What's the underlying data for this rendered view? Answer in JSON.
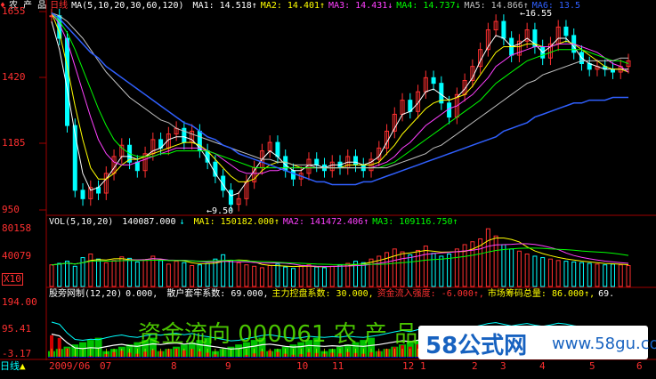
{
  "main": {
    "title": "农 产 品",
    "period": "日线",
    "ma_params": "MA(5,10,20,30,60,120)",
    "ma_values": [
      {
        "label": "MA1:",
        "value": "14.518",
        "arrow": "↑",
        "color": "#ffffff"
      },
      {
        "label": "MA2:",
        "value": "14.401",
        "arrow": "↑",
        "color": "#ffff00"
      },
      {
        "label": "MA3:",
        "value": "14.431",
        "arrow": "↓",
        "color": "#ff40ff"
      },
      {
        "label": "MA4:",
        "value": "14.737",
        "arrow": "↓",
        "color": "#00ff00"
      },
      {
        "label": "MA5:",
        "value": "14.866",
        "arrow": "↑",
        "color": "#c0c0c0"
      },
      {
        "label": "MA6:",
        "value": "13.5",
        "arrow": "",
        "color": "#3060ff"
      }
    ],
    "price_labels": [
      "1655",
      "1420",
      "1185",
      "950"
    ],
    "high_annotation": "16.55",
    "low_annotation": "9.50"
  },
  "volume": {
    "header": "VOL(5,10,20)",
    "vol_value": "140087.000",
    "vol_arrow": "↓",
    "ma_values": [
      {
        "label": "MA1:",
        "value": "150182.000",
        "arrow": "↑",
        "color": "#ffff00"
      },
      {
        "label": "MA2:",
        "value": "141472.406",
        "arrow": "↑",
        "color": "#ff40ff"
      },
      {
        "label": "MA3:",
        "value": "109116.750",
        "arrow": "↑",
        "color": "#00ff00"
      }
    ],
    "axis_labels": [
      "80158",
      "40079"
    ],
    "multiplier": "X10"
  },
  "indicator": {
    "name": "股旁网制(12,20)",
    "value0": "0.000,",
    "items": [
      {
        "label": "散户套牢系数:",
        "value": "69.000,",
        "color": "#ffffff"
      },
      {
        "label": "主力控盘系数:",
        "value": "30.000,",
        "color": "#ffff00"
      },
      {
        "label": "资金流入强度:",
        "value": "-6.000",
        "arrow": "↑,",
        "color": "#ff3030"
      },
      {
        "label": "市场筹码总量:",
        "value": "86.000",
        "arrow": "↑,",
        "color": "#ffff00"
      },
      {
        "label": "",
        "value": "69.",
        "color": "#ffffff"
      }
    ],
    "axis_labels": [
      "194.00",
      "95.41",
      "-3.17"
    ]
  },
  "xaxis": {
    "period_button": "日线",
    "ticks": [
      "2009/06",
      "07",
      "8",
      "9",
      "10",
      "11",
      "12",
      "1",
      "2",
      "3",
      "4",
      "5",
      "6"
    ]
  },
  "watermark": "资金流向 000061 农 产 品",
  "logo": {
    "text": "58公式网",
    "url": "www.58gu.com"
  },
  "colors": {
    "up": "#ff3030",
    "down": "#00ffff",
    "ma1": "#ffffff",
    "ma2": "#ffff00",
    "ma3": "#ff40ff",
    "ma4": "#00ff00",
    "ma5": "#c0c0c0",
    "ma6": "#3060ff"
  },
  "chart_data": {
    "type": "line",
    "y_range": [
      9.5,
      16.55
    ],
    "close_series": {
      "name": "close",
      "values": [
        16.4,
        15.6,
        12.5,
        10.2,
        9.9,
        10.3,
        10.1,
        10.8,
        11.4,
        11.8,
        11.2,
        10.9,
        11.5,
        12.0,
        11.7,
        12.2,
        12.4,
        11.9,
        12.3,
        11.6,
        11.2,
        10.7,
        10.2,
        9.7,
        9.9,
        10.5,
        11.0,
        11.6,
        11.9,
        11.4,
        10.9,
        10.6,
        10.8,
        11.3,
        11.1,
        10.9,
        11.2,
        11.0,
        11.4,
        11.1,
        10.9,
        11.3,
        11.7,
        12.3,
        12.9,
        13.4,
        13.0,
        13.7,
        14.2,
        14.0,
        13.3,
        12.8,
        13.6,
        14.1,
        14.6,
        15.2,
        15.9,
        16.2,
        15.6,
        15.0,
        15.5,
        15.9,
        15.3,
        14.9,
        15.4,
        16.0,
        15.7,
        15.1,
        14.7,
        14.5,
        14.6,
        14.5,
        14.4,
        14.6,
        14.8
      ]
    },
    "ma_series": [
      {
        "name": "MA1",
        "values": [
          16.2,
          15.2,
          13.8,
          12.2,
          10.8,
          10.2,
          10.3,
          10.6,
          11.0,
          11.4,
          11.4,
          11.3,
          11.4,
          11.6,
          11.7,
          12.0,
          12.1,
          12.1,
          12.0,
          11.7,
          11.3,
          10.8,
          10.4,
          10.0,
          10.1,
          10.5,
          10.9,
          11.3,
          11.6,
          11.4,
          11.1,
          10.9,
          10.9,
          11.1,
          11.1,
          11.0,
          11.1,
          11.1,
          11.2,
          11.2,
          11.1,
          11.2,
          11.4,
          11.9,
          12.4,
          12.9,
          13.0,
          13.3,
          13.7,
          13.8,
          13.6,
          13.4,
          13.5,
          13.8,
          14.2,
          14.8,
          15.3,
          15.7,
          15.6,
          15.3,
          15.4,
          15.6,
          15.4,
          15.1,
          15.3,
          15.6,
          15.6,
          15.3,
          14.9,
          14.7,
          14.6,
          14.5,
          14.5,
          14.5,
          14.5
        ]
      },
      {
        "name": "MA2",
        "values": [
          16.5,
          15.8,
          14.6,
          13.2,
          12.0,
          11.0,
          10.6,
          10.6,
          10.8,
          11.1,
          11.3,
          11.3,
          11.4,
          11.5,
          11.6,
          11.7,
          11.8,
          11.9,
          11.9,
          11.8,
          11.6,
          11.3,
          11.0,
          10.7,
          10.5,
          10.5,
          10.6,
          10.9,
          11.1,
          11.2,
          11.2,
          11.1,
          11.0,
          11.0,
          11.0,
          11.0,
          11.0,
          11.0,
          11.1,
          11.1,
          11.1,
          11.1,
          11.2,
          11.5,
          11.8,
          12.2,
          12.5,
          12.8,
          13.1,
          13.3,
          13.4,
          13.4,
          13.5,
          13.6,
          13.9,
          14.3,
          14.7,
          15.1,
          15.3,
          15.3,
          15.3,
          15.4,
          15.4,
          15.3,
          15.3,
          15.4,
          15.5,
          15.4,
          15.2,
          15.0,
          14.8,
          14.6,
          14.5,
          14.5,
          14.4
        ]
      },
      {
        "name": "MA3",
        "values": [
          16.5,
          16.1,
          15.5,
          14.6,
          13.7,
          12.8,
          12.0,
          11.5,
          11.2,
          11.1,
          11.1,
          11.2,
          11.3,
          11.4,
          11.5,
          11.6,
          11.7,
          11.7,
          11.7,
          11.7,
          11.6,
          11.5,
          11.3,
          11.1,
          10.9,
          10.8,
          10.8,
          10.8,
          10.9,
          10.9,
          11.0,
          11.0,
          11.0,
          11.0,
          11.0,
          11.0,
          11.0,
          11.0,
          11.0,
          11.0,
          11.0,
          11.0,
          11.1,
          11.2,
          11.4,
          11.7,
          11.9,
          12.2,
          12.5,
          12.7,
          12.9,
          13.1,
          13.2,
          13.4,
          13.6,
          13.9,
          14.2,
          14.6,
          14.8,
          15.0,
          15.1,
          15.2,
          15.3,
          15.3,
          15.3,
          15.4,
          15.4,
          15.4,
          15.3,
          15.2,
          15.1,
          14.9,
          14.7,
          14.6,
          14.4
        ]
      },
      {
        "name": "MA4",
        "values": [
          16.5,
          16.2,
          15.8,
          15.2,
          14.5,
          13.8,
          13.1,
          12.5,
          12.0,
          11.7,
          11.5,
          11.4,
          11.4,
          11.4,
          11.5,
          11.5,
          11.6,
          11.6,
          11.6,
          11.6,
          11.6,
          11.5,
          11.4,
          11.3,
          11.2,
          11.1,
          11.0,
          11.0,
          11.0,
          11.0,
          11.0,
          11.0,
          11.0,
          11.0,
          11.0,
          11.0,
          11.0,
          11.0,
          11.0,
          11.0,
          11.0,
          11.0,
          11.0,
          11.1,
          11.2,
          11.4,
          11.6,
          11.8,
          12.0,
          12.2,
          12.4,
          12.6,
          12.8,
          13.0,
          13.2,
          13.4,
          13.7,
          14.0,
          14.2,
          14.4,
          14.6,
          14.8,
          14.9,
          15.0,
          15.1,
          15.2,
          15.2,
          15.2,
          15.2,
          15.1,
          15.0,
          14.9,
          14.8,
          14.8,
          14.7
        ]
      },
      {
        "name": "MA5",
        "values": [
          16.5,
          16.4,
          16.2,
          15.9,
          15.6,
          15.2,
          14.8,
          14.4,
          14.1,
          13.8,
          13.5,
          13.3,
          13.1,
          12.9,
          12.7,
          12.6,
          12.4,
          12.3,
          12.2,
          12.1,
          12.0,
          11.9,
          11.8,
          11.7,
          11.6,
          11.5,
          11.4,
          11.3,
          11.3,
          11.2,
          11.2,
          11.1,
          11.1,
          11.1,
          11.0,
          11.0,
          11.0,
          11.0,
          11.0,
          11.0,
          11.0,
          11.0,
          11.0,
          11.0,
          11.1,
          11.2,
          11.3,
          11.4,
          11.5,
          11.7,
          11.8,
          12.0,
          12.2,
          12.4,
          12.6,
          12.8,
          13.0,
          13.2,
          13.4,
          13.6,
          13.8,
          14.0,
          14.1,
          14.3,
          14.4,
          14.5,
          14.6,
          14.7,
          14.8,
          14.8,
          14.8,
          14.8,
          14.8,
          14.9,
          14.9
        ]
      },
      {
        "name": "MA6",
        "values": [
          16.5,
          16.3,
          16.0,
          15.7,
          15.4,
          15.1,
          14.9,
          14.6,
          14.4,
          14.2,
          14.0,
          13.8,
          13.6,
          13.4,
          13.2,
          13.0,
          12.8,
          12.6,
          12.5,
          12.3,
          12.1,
          12.0,
          11.8,
          11.7,
          11.5,
          11.4,
          11.3,
          11.2,
          11.1,
          11.0,
          10.9,
          10.8,
          10.7,
          10.6,
          10.5,
          10.5,
          10.4,
          10.4,
          10.4,
          10.4,
          10.5,
          10.5,
          10.6,
          10.7,
          10.8,
          10.9,
          11.0,
          11.1,
          11.2,
          11.3,
          11.4,
          11.5,
          11.6,
          11.7,
          11.8,
          11.9,
          12.0,
          12.1,
          12.3,
          12.4,
          12.5,
          12.6,
          12.8,
          12.9,
          13.0,
          13.1,
          13.2,
          13.3,
          13.3,
          13.4,
          13.4,
          13.4,
          13.5,
          13.5,
          13.5
        ]
      }
    ],
    "volume": {
      "y_range": [
        0,
        80158
      ],
      "values": [
        30000,
        32000,
        35000,
        28000,
        40000,
        45000,
        38000,
        33000,
        36000,
        41000,
        39000,
        34000,
        37000,
        42000,
        36000,
        31000,
        35000,
        33000,
        29000,
        30000,
        32000,
        38000,
        44000,
        36000,
        33000,
        30000,
        28000,
        26000,
        29000,
        31000,
        27000,
        25000,
        28000,
        30000,
        27000,
        26000,
        28000,
        30000,
        32000,
        35000,
        33000,
        38000,
        42000,
        47000,
        52000,
        48000,
        44000,
        50000,
        56000,
        46000,
        42000,
        45000,
        52000,
        58000,
        62000,
        66000,
        80000,
        70000,
        58000,
        52000,
        49000,
        45000,
        42000,
        40000,
        38000,
        36000,
        35000,
        34000,
        33000,
        32000,
        31000,
        30000,
        31000,
        30000,
        29000
      ]
    },
    "indicator_range": [
      -3.17,
      194.0
    ]
  }
}
